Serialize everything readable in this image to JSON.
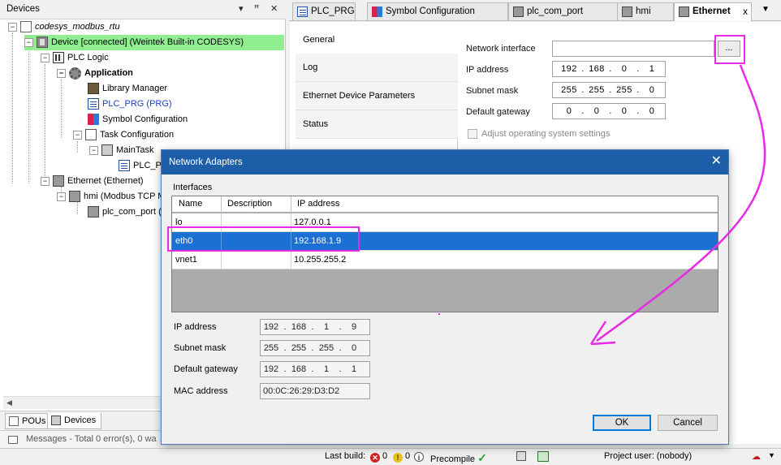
{
  "devices": {
    "title": "Devices",
    "pin_glyph": "▾",
    "pushpin_glyph": "ꟸ",
    "close_glyph": "✕",
    "tree": [
      {
        "label": "codesys_modbus_rtu"
      },
      {
        "label": "Device [connected] (Weintek Built-in CODESYS)"
      },
      {
        "label": "PLC Logic"
      },
      {
        "label": "Application"
      },
      {
        "label": "Library Manager"
      },
      {
        "label": "PLC_PRG (PRG)"
      },
      {
        "label": "Symbol Configuration"
      },
      {
        "label": "Task Configuration"
      },
      {
        "label": "MainTask"
      },
      {
        "label": "PLC_P"
      },
      {
        "label": "Ethernet (Ethernet)"
      },
      {
        "label": "hmi (Modbus TCP M"
      },
      {
        "label": "plc_com_port ("
      }
    ],
    "bottom_tabs": [
      "POUs",
      "Devices"
    ]
  },
  "messages": {
    "text": "Messages - Total 0 error(s), 0 wa"
  },
  "editor_tabs": [
    {
      "label": "PLC_PRG"
    },
    {
      "label": "Symbol Configuration"
    },
    {
      "label": "plc_com_port"
    },
    {
      "label": "hmi"
    },
    {
      "label": "Ethernet",
      "close": "x"
    }
  ],
  "side_tabs": [
    "General",
    "Log",
    "Ethernet Device Parameters",
    "Status"
  ],
  "general": {
    "network_interface_label": "Network interface",
    "network_interface_value": "",
    "browse_label": "...",
    "ip_label": "IP address",
    "ip": [
      "192",
      "168",
      "0",
      "1"
    ],
    "subnet_label": "Subnet mask",
    "subnet": [
      "255",
      "255",
      "255",
      "0"
    ],
    "gateway_label": "Default gateway",
    "gateway": [
      "0",
      "0",
      "0",
      "0"
    ],
    "adjust_label": "Adjust operating system settings"
  },
  "dialog": {
    "title": "Network Adapters",
    "interfaces_label": "Interfaces",
    "columns": [
      "Name",
      "Description",
      "IP address"
    ],
    "rows": [
      {
        "name": "lo",
        "description": "",
        "ip": "127.0.0.1"
      },
      {
        "name": "eth0",
        "description": "",
        "ip": "192.168.1.9"
      },
      {
        "name": "vnet1",
        "description": "",
        "ip": "10.255.255.2"
      }
    ],
    "ip_label": "IP address",
    "ip": [
      "192",
      "168",
      "1",
      "9"
    ],
    "subnet_label": "Subnet mask",
    "subnet": [
      "255",
      "255",
      "255",
      "0"
    ],
    "gateway_label": "Default gateway",
    "gateway": [
      "192",
      "168",
      "1",
      "1"
    ],
    "mac_label": "MAC address",
    "mac": "00:0C:26:29:D3:D2",
    "ok_label": "OK",
    "cancel_label": "Cancel"
  },
  "status_bar": {
    "last_build_label": "Last build:",
    "errors": "0",
    "warnings": "0",
    "precompile_label": "Precompile",
    "project_user": "Project user: (nobody)"
  },
  "colors": {
    "selection": "#1a70d3",
    "dialog_title": "#1c5ea8",
    "connected_device": "#90ee90",
    "annotation": "#e62ae6"
  }
}
